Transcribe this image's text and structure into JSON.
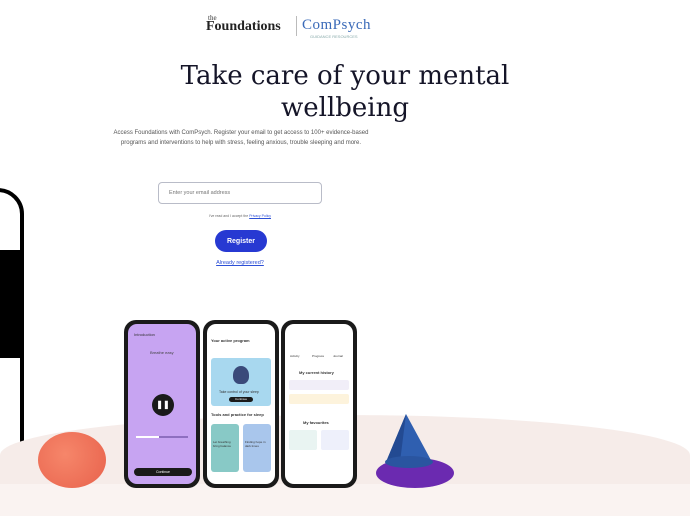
{
  "logos": {
    "the": "the",
    "foundations": "Foundations",
    "partner": "ComPsych",
    "partner_tagline": "GUIDANCE RESOURCES"
  },
  "headline": {
    "line1": "Take care of your mental",
    "line2": "wellbeing"
  },
  "description": "Access Foundations with ComPsych. Register your email to get access to 100+ evidence-based programs and interventions to help with stress, feeling anxious, trouble sleeping and more.",
  "email_field": {
    "placeholder": "Enter your email address",
    "value": ""
  },
  "consent": {
    "text": "I've read and I accept the",
    "link": "Privacy Policy"
  },
  "register_button": "Register",
  "already_registered": "Already registered?",
  "phones": {
    "left": {
      "header": "Introduction",
      "subtitle": "Breathe easy",
      "button": "Continue",
      "progress": 0.45
    },
    "middle": {
      "title": "Your active program",
      "card_label": "Take control of your sleep",
      "card_button": "Continue",
      "section": "Tools and practice for sleep",
      "tile1": "Let breathing bring balance",
      "tile2": "Finding hope in dark times"
    },
    "right": {
      "tab1": "Activity",
      "tab2": "Progress",
      "tab3": "Journal",
      "section1": "My current history",
      "section2": "My favourites"
    }
  },
  "colors": {
    "accent": "#2739d2",
    "phone_purple": "#c7a4f2",
    "ball": "#e8624c",
    "cone_blue": "#2f5fb0",
    "base_purple": "#6b2ab0",
    "ground": "#f6ece9"
  }
}
